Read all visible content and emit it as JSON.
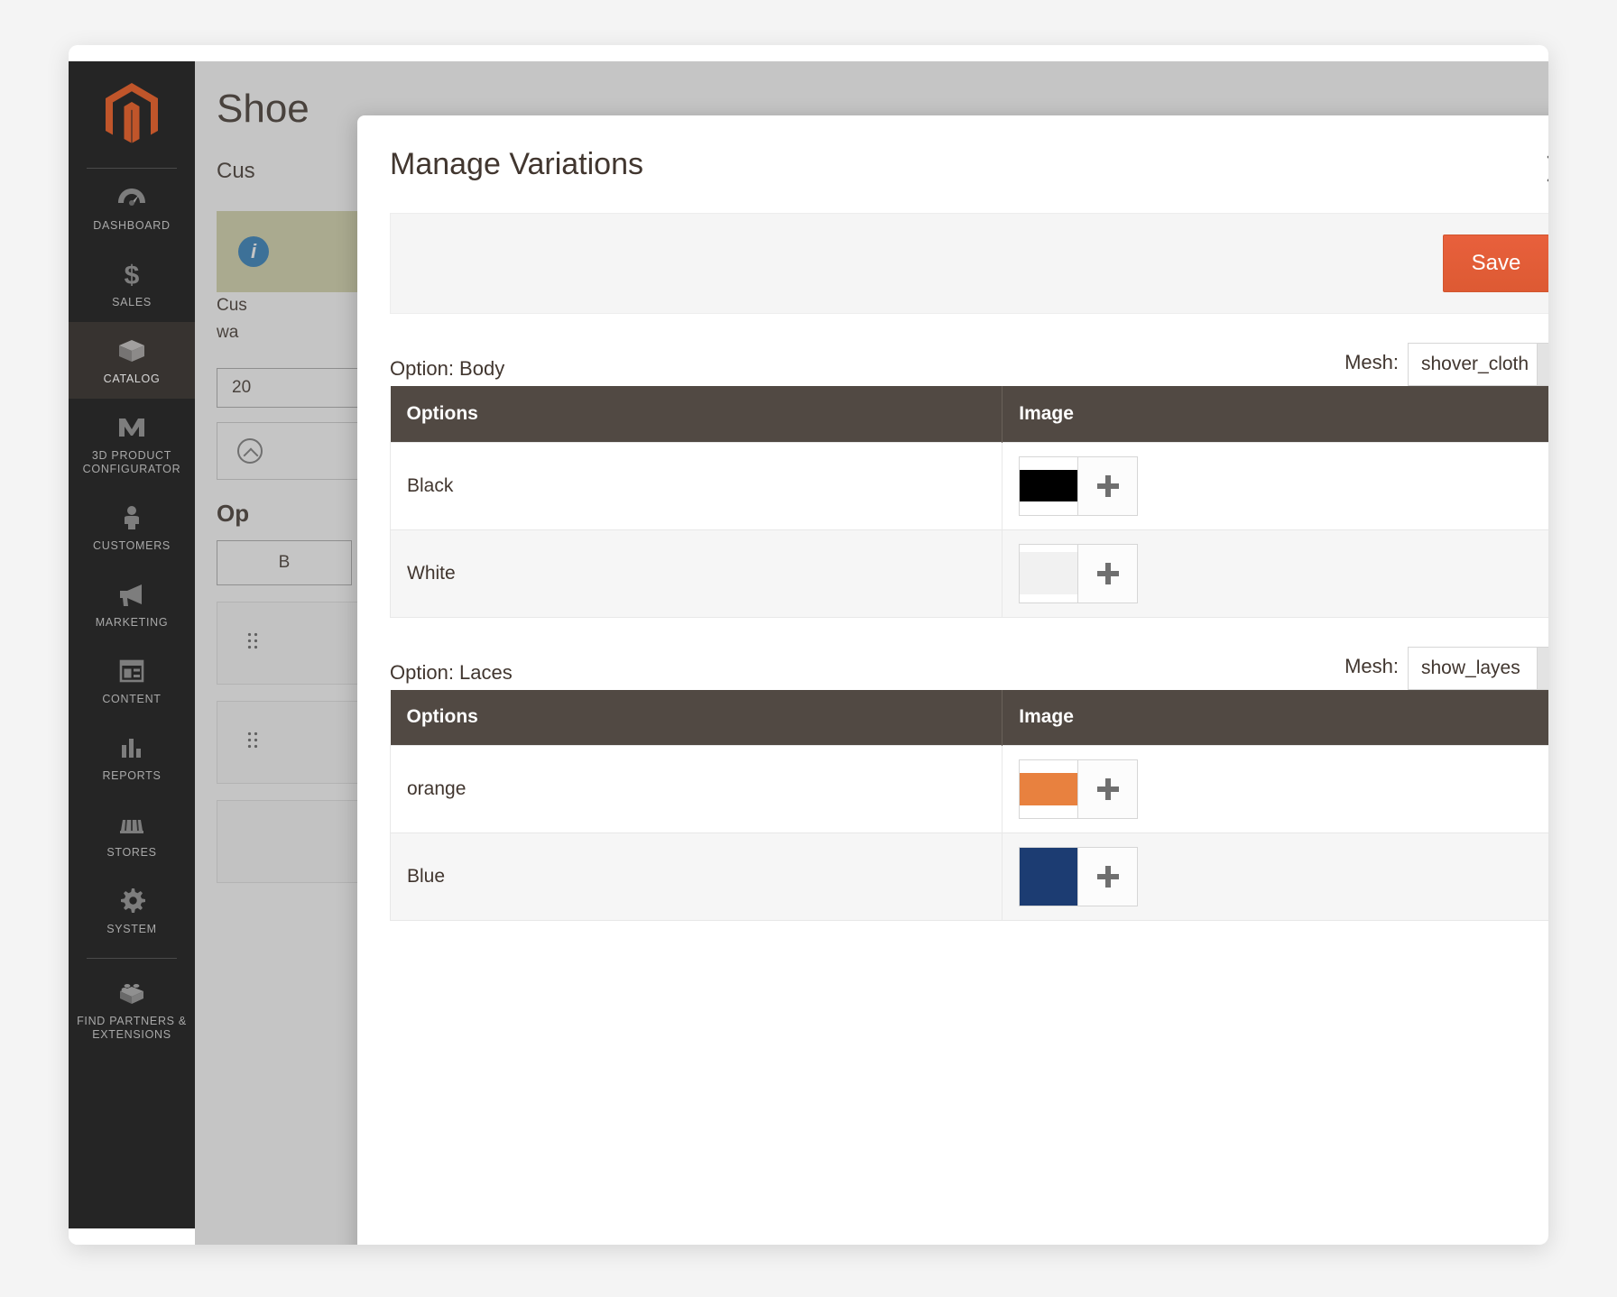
{
  "sidebar": {
    "logo_icon": "magento-logo-icon",
    "items": [
      {
        "label": "DASHBOARD",
        "icon": "dashboard-gauge-icon",
        "active": false
      },
      {
        "label": "SALES",
        "icon": "dollar-sign-icon",
        "active": false
      },
      {
        "label": "CATALOG",
        "icon": "box-package-icon",
        "active": true
      },
      {
        "label": "3D PRODUCT CONFIGURATOR",
        "icon": "m-letter-icon",
        "active": false
      },
      {
        "label": "CUSTOMERS",
        "icon": "person-icon",
        "active": false
      },
      {
        "label": "MARKETING",
        "icon": "megaphone-icon",
        "active": false
      },
      {
        "label": "CONTENT",
        "icon": "layout-panel-icon",
        "active": false
      },
      {
        "label": "REPORTS",
        "icon": "bar-chart-icon",
        "active": false
      },
      {
        "label": "STORES",
        "icon": "storefront-awning-icon",
        "active": false
      },
      {
        "label": "SYSTEM",
        "icon": "gear-icon",
        "active": false
      },
      {
        "label": "FIND PARTNERS & EXTENSIONS",
        "icon": "lego-brick-icon",
        "active": false
      }
    ]
  },
  "background_page": {
    "title": "Shoe",
    "subtitle": "Cus",
    "notice_icon": "info-circle-icon",
    "notice_text_line1": "Cus",
    "notice_text_line2": "wa",
    "input_value": "20",
    "collapse_icon": "chevron-up-circle-icon",
    "section_title": "Op",
    "button_label": "B",
    "drag_icon": "drag-handle-icon"
  },
  "modal": {
    "title": "Manage Variations",
    "close_icon": "close-x-icon",
    "save_label": "Save",
    "accent_color": "#e8603c",
    "header_color": "#514943"
  },
  "sections": [
    {
      "option_label": "Option: Body",
      "mesh_label": "Mesh:",
      "mesh_value": "shover_cloth",
      "mesh_arrow_icon": "chevron-down-icon",
      "columns": [
        "Options",
        "Image"
      ],
      "rows": [
        {
          "option": "Black",
          "swatch_color": "#000000",
          "swatch_height_pct": 56,
          "add_icon": "plus-icon"
        },
        {
          "option": "White",
          "swatch_color": "#f1f1f1",
          "swatch_height_pct": 72,
          "add_icon": "plus-icon"
        }
      ]
    },
    {
      "option_label": "Option: Laces",
      "mesh_label": "Mesh:",
      "mesh_value": "show_layes",
      "mesh_arrow_icon": "chevron-down-icon",
      "columns": [
        "Options",
        "Image"
      ],
      "rows": [
        {
          "option": "orange",
          "swatch_color": "#e8813f",
          "swatch_height_pct": 56,
          "add_icon": "plus-icon"
        },
        {
          "option": "Blue",
          "swatch_color": "#1c3c72",
          "swatch_height_pct": 100,
          "add_icon": "plus-icon"
        }
      ]
    }
  ]
}
